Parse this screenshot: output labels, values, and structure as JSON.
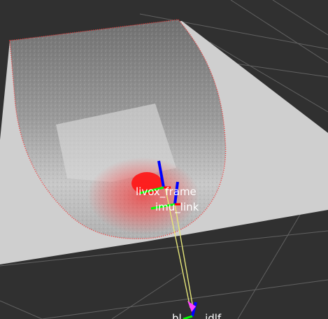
{
  "scene": {
    "background_color": "#303030",
    "grid_color": "#8a8a8a",
    "plane_color": "#cfcfcf",
    "cloud_low_intensity_color": "#ff2020",
    "frames": [
      {
        "label": "livox_frame"
      },
      {
        "label": "imu_link"
      },
      {
        "label": "bl... ...idlf"
      }
    ],
    "axis_colors": {
      "x": "#ff0000",
      "y": "#00ff00",
      "z": "#0000ff"
    },
    "tf_link_color": "#e6e67a"
  }
}
